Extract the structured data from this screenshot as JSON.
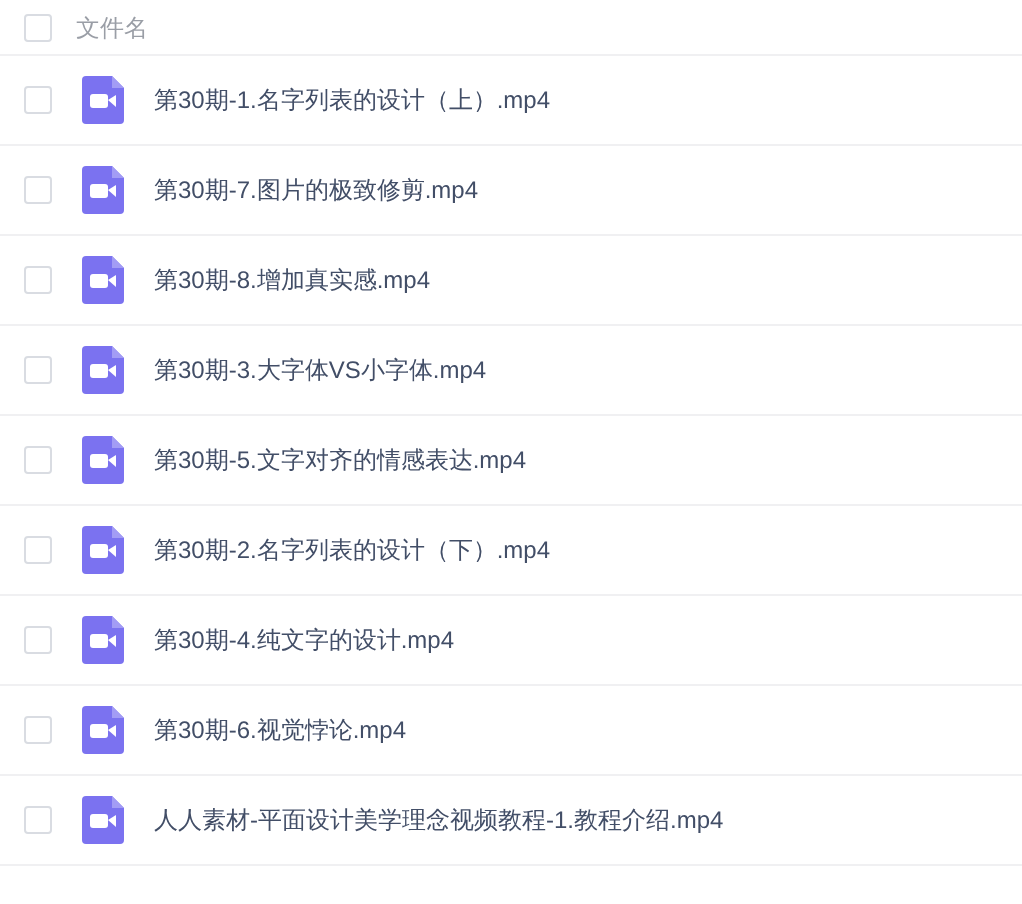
{
  "header": {
    "checked": false,
    "label": "文件名"
  },
  "files": [
    {
      "name": "第30期-1.名字列表的设计（上）.mp4",
      "checked": false
    },
    {
      "name": "第30期-7.图片的极致修剪.mp4",
      "checked": false
    },
    {
      "name": "第30期-8.增加真实感.mp4",
      "checked": false
    },
    {
      "name": "第30期-3.大字体VS小字体.mp4",
      "checked": false
    },
    {
      "name": "第30期-5.文字对齐的情感表达.mp4",
      "checked": false
    },
    {
      "name": "第30期-2.名字列表的设计（下）.mp4",
      "checked": false
    },
    {
      "name": "第30期-4.纯文字的设计.mp4",
      "checked": false
    },
    {
      "name": "第30期-6.视觉悖论.mp4",
      "checked": false
    },
    {
      "name": "人人素材-平面设计美学理念视频教程-1.教程介绍.mp4",
      "checked": false
    }
  ]
}
